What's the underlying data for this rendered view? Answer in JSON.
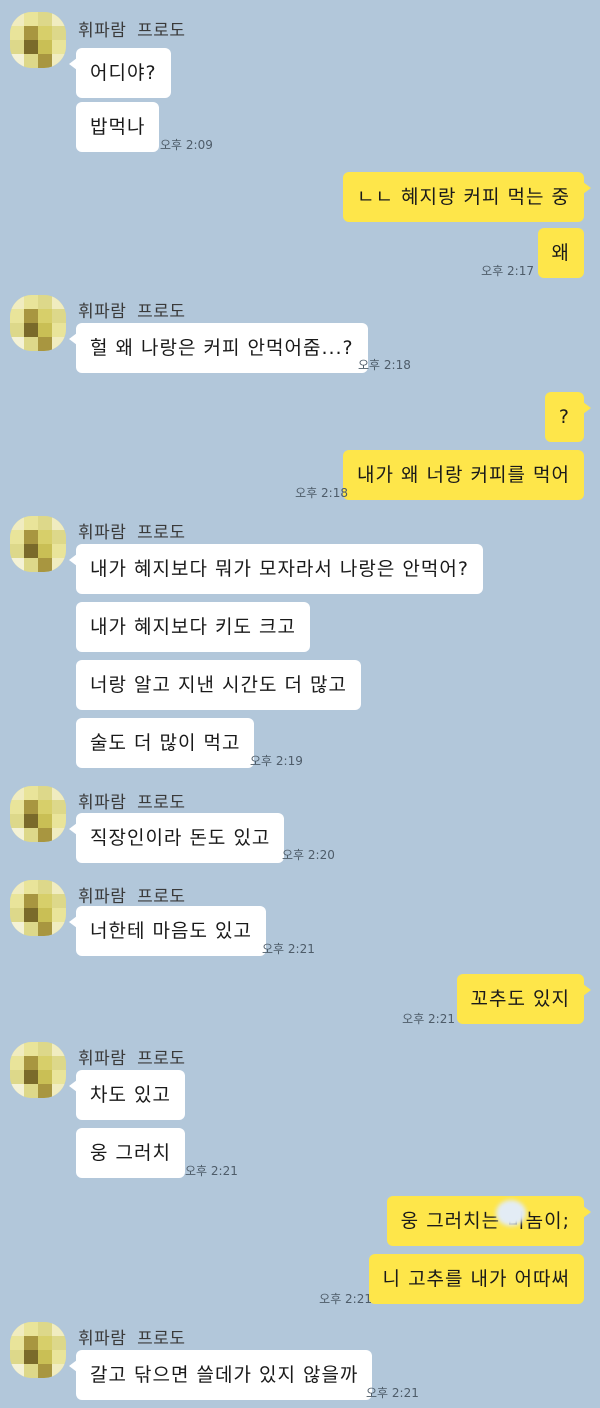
{
  "sender_name": "휘파람 프로도",
  "messages": [
    {
      "text": "어디야?"
    },
    {
      "text": "밥먹나"
    },
    {
      "text": "ㄴㄴ 혜지랑 커피 먹는 중"
    },
    {
      "text": "왜"
    },
    {
      "text": "헐 왜 나랑은 커피 안먹어줌...?"
    },
    {
      "text": "?"
    },
    {
      "text": "내가 왜 너랑 커피를 먹어"
    },
    {
      "text": "내가 혜지보다 뭐가 모자라서 나랑은 안먹어?"
    },
    {
      "text": "내가 혜지보다 키도 크고"
    },
    {
      "text": "너랑 알고 지낸 시간도 더 많고"
    },
    {
      "text": "술도 더 많이 먹고"
    },
    {
      "text": "직장인이라 돈도 있고"
    },
    {
      "text": "너한테 마음도 있고"
    },
    {
      "text": "꼬추도 있지"
    },
    {
      "text": "차도 있고"
    },
    {
      "text": "웅 그러치"
    },
    {
      "text": "웅 그러치는 미놈이;"
    },
    {
      "text": "니 고추를 내가 어따써"
    },
    {
      "text": "갈고 닦으면 쓸데가 있지 않을까"
    }
  ],
  "timestamps": [
    "오후 2:09",
    "오후 2:17",
    "오후 2:18",
    "오후 2:18",
    "오후 2:19",
    "오후 2:20",
    "오후 2:21",
    "오후 2:21",
    "오후 2:21",
    "오후 2:21",
    "오후 2:21"
  ],
  "colors": {
    "background": "#b2c7da",
    "incoming_bubble": "#ffffff",
    "outgoing_bubble": "#fee64a",
    "avatar": "#e2dc86"
  },
  "icons": {
    "avatar": "pixelated-profile-avatar-icon"
  }
}
